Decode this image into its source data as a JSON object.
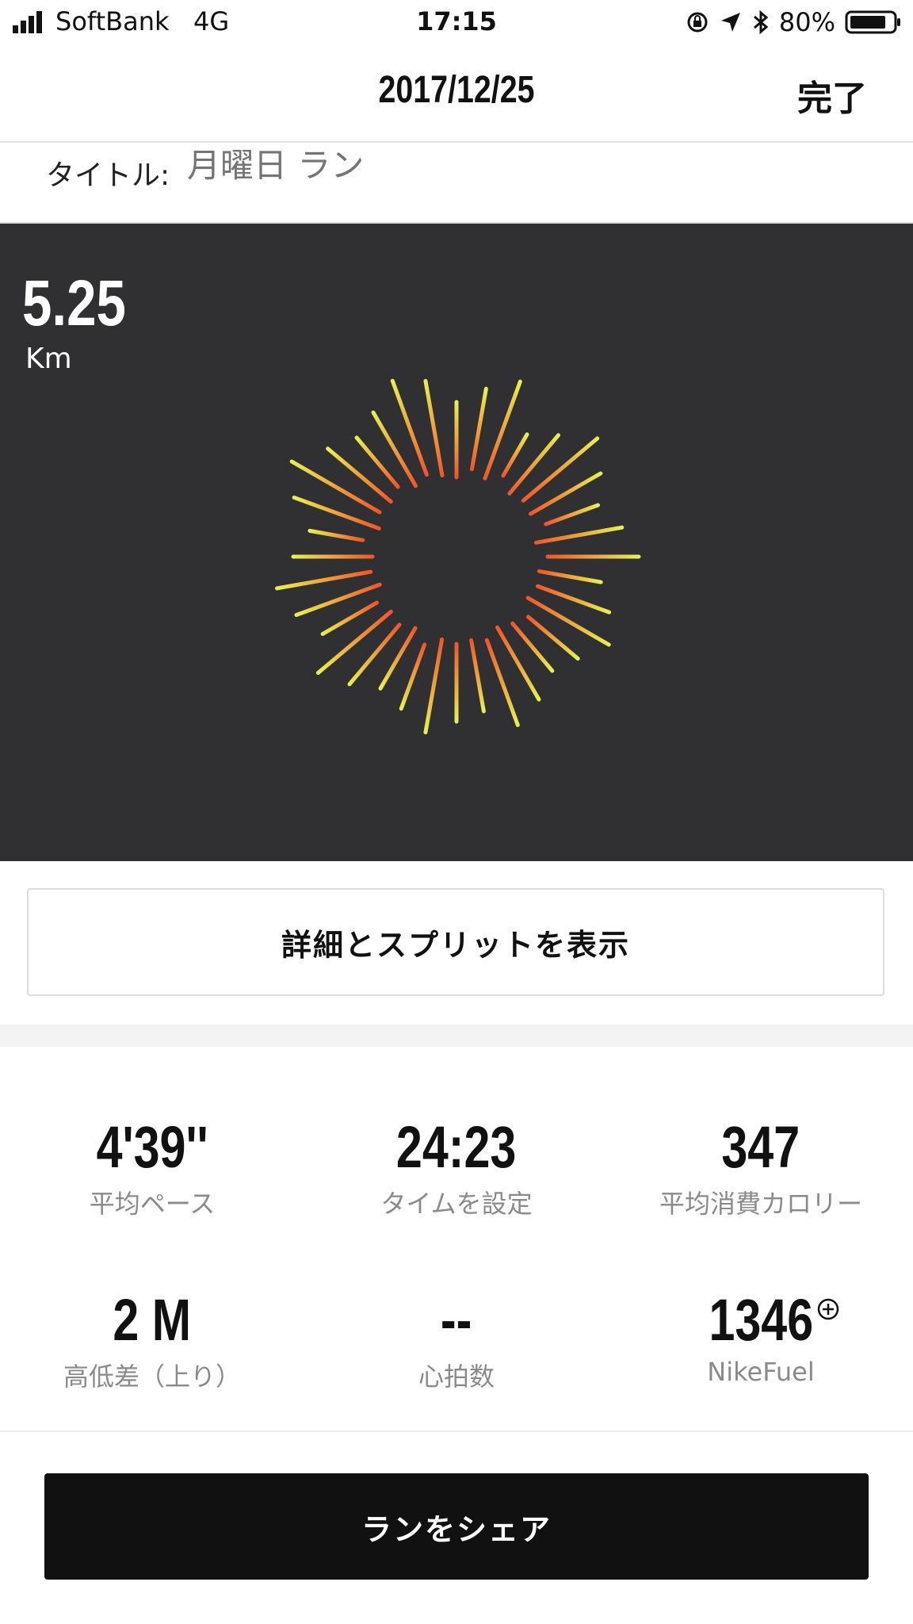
{
  "status_bar": {
    "carrier": "SoftBank",
    "network": "4G",
    "time": "17:15",
    "battery_percent": "80%",
    "icons": [
      "signal-icon",
      "lock-rotation-icon",
      "location-arrow-icon",
      "bluetooth-icon",
      "battery-icon"
    ]
  },
  "header": {
    "date": "2017/12/25",
    "done_label": "完了"
  },
  "title_field": {
    "label": "タイトル:",
    "placeholder": "月曜日 ラン"
  },
  "run": {
    "distance": "5.25",
    "unit": "Km",
    "colors": {
      "panel": "#303032",
      "inner": "#f0562a",
      "outer": "#e8f050"
    }
  },
  "detail_button": {
    "label": "詳細とスプリットを表示"
  },
  "stats": [
    {
      "value": "4'39''",
      "label": "平均ペース"
    },
    {
      "value": "24:23",
      "label": "タイムを設定"
    },
    {
      "value": "347",
      "label": "平均消費カロリー"
    },
    {
      "value": "2 M",
      "label": "高低差（上り）"
    },
    {
      "value": "--",
      "label": "心拍数"
    },
    {
      "value": "1346",
      "label": "NikeFuel"
    }
  ],
  "share_button": {
    "label": "ランをシェア"
  }
}
